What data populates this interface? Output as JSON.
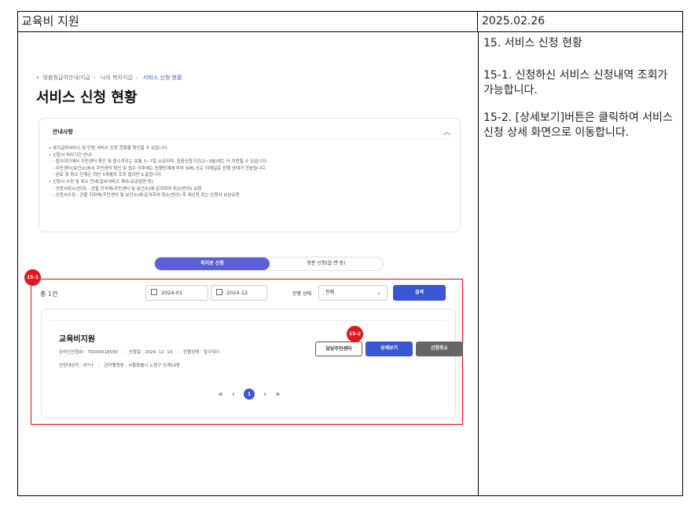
{
  "header": {
    "title": "교육비 지원",
    "date": "2025.02.26"
  },
  "description": {
    "title": "15. 서비스 신청 현황",
    "items": [
      "15-1. 신청하신 서비스 신청내역 조회가 가능합니다.",
      "15-2. [상세보기]버튼은 클릭하여 서비스 신청 상세 화면으로 이동합니다."
    ]
  },
  "screen": {
    "breadcrumb": [
      "맞춤형급여안내/지급",
      "나의 복지지갑",
      "서비스 신청 현황"
    ],
    "page_title": "서비스 신청 현황",
    "notice": {
      "title": "안내사항",
      "lines": [
        "• 복지급여서비스 및 민원 서비스 신청 현황을 확인할 수 있습니다.",
        "• 신청서 처리기간 안내",
        "- 접수대기에서 주민센터 확인 및 접수까지는 보통 3~7일 소요되며, 집중신청기간(2~3월)에는 더 지연될 수 있습니다.",
        "- 주민센터(보건소)에서 주민센터 확인 및 접수 이후에는 진행단계에 따라 SMS 또는 이메일로 진행 상태가 전송됩니다.",
        "- 완료 및 취소 단계는 최신 3개월의 조회 결과만 노출됩니다.",
        "• 신청서 수정 및 취소 안내(일부서비스 제외-요금감면 등)",
        "- 신청서취소(반려) : 관할 지자체(주민센터 및 보건소)에 문의하여 취소(반려) 요청",
        "- 신청서수정 : 관할 지자체(주민센터 및 보건소)에 문의하여 취소(반려) 후 재신청 또는 신청서 보완요청"
      ]
    },
    "tabs": [
      "복지로 신청",
      "방문 신청(읍·면·동)"
    ],
    "filter": {
      "total_prefix": "총 ",
      "total_count": "1",
      "total_suffix": "건",
      "date_from": "2024-01",
      "date_to": "2024-12",
      "status_label": "진행 상태",
      "status_value": "전체",
      "search_label": "검색"
    },
    "card": {
      "title": "교육비지원",
      "online_id": "온라인신청ID : T0000018590",
      "applied_date": "신청일 : 2024. 12. 19",
      "status": "진행상태 : 접수대기",
      "applicant": "신청대상자 : 이*나",
      "office": "관리행정동 : 서울특별시 노원구 상계10동",
      "btn_center": "담당주민센터",
      "btn_detail": "상세보기",
      "btn_cancel": "신청취소"
    },
    "pager": {
      "first": "«",
      "prev": "‹",
      "current": "1",
      "next": "›",
      "last": "»"
    }
  },
  "badges": {
    "b1": "15-1",
    "b2": "15-2"
  }
}
